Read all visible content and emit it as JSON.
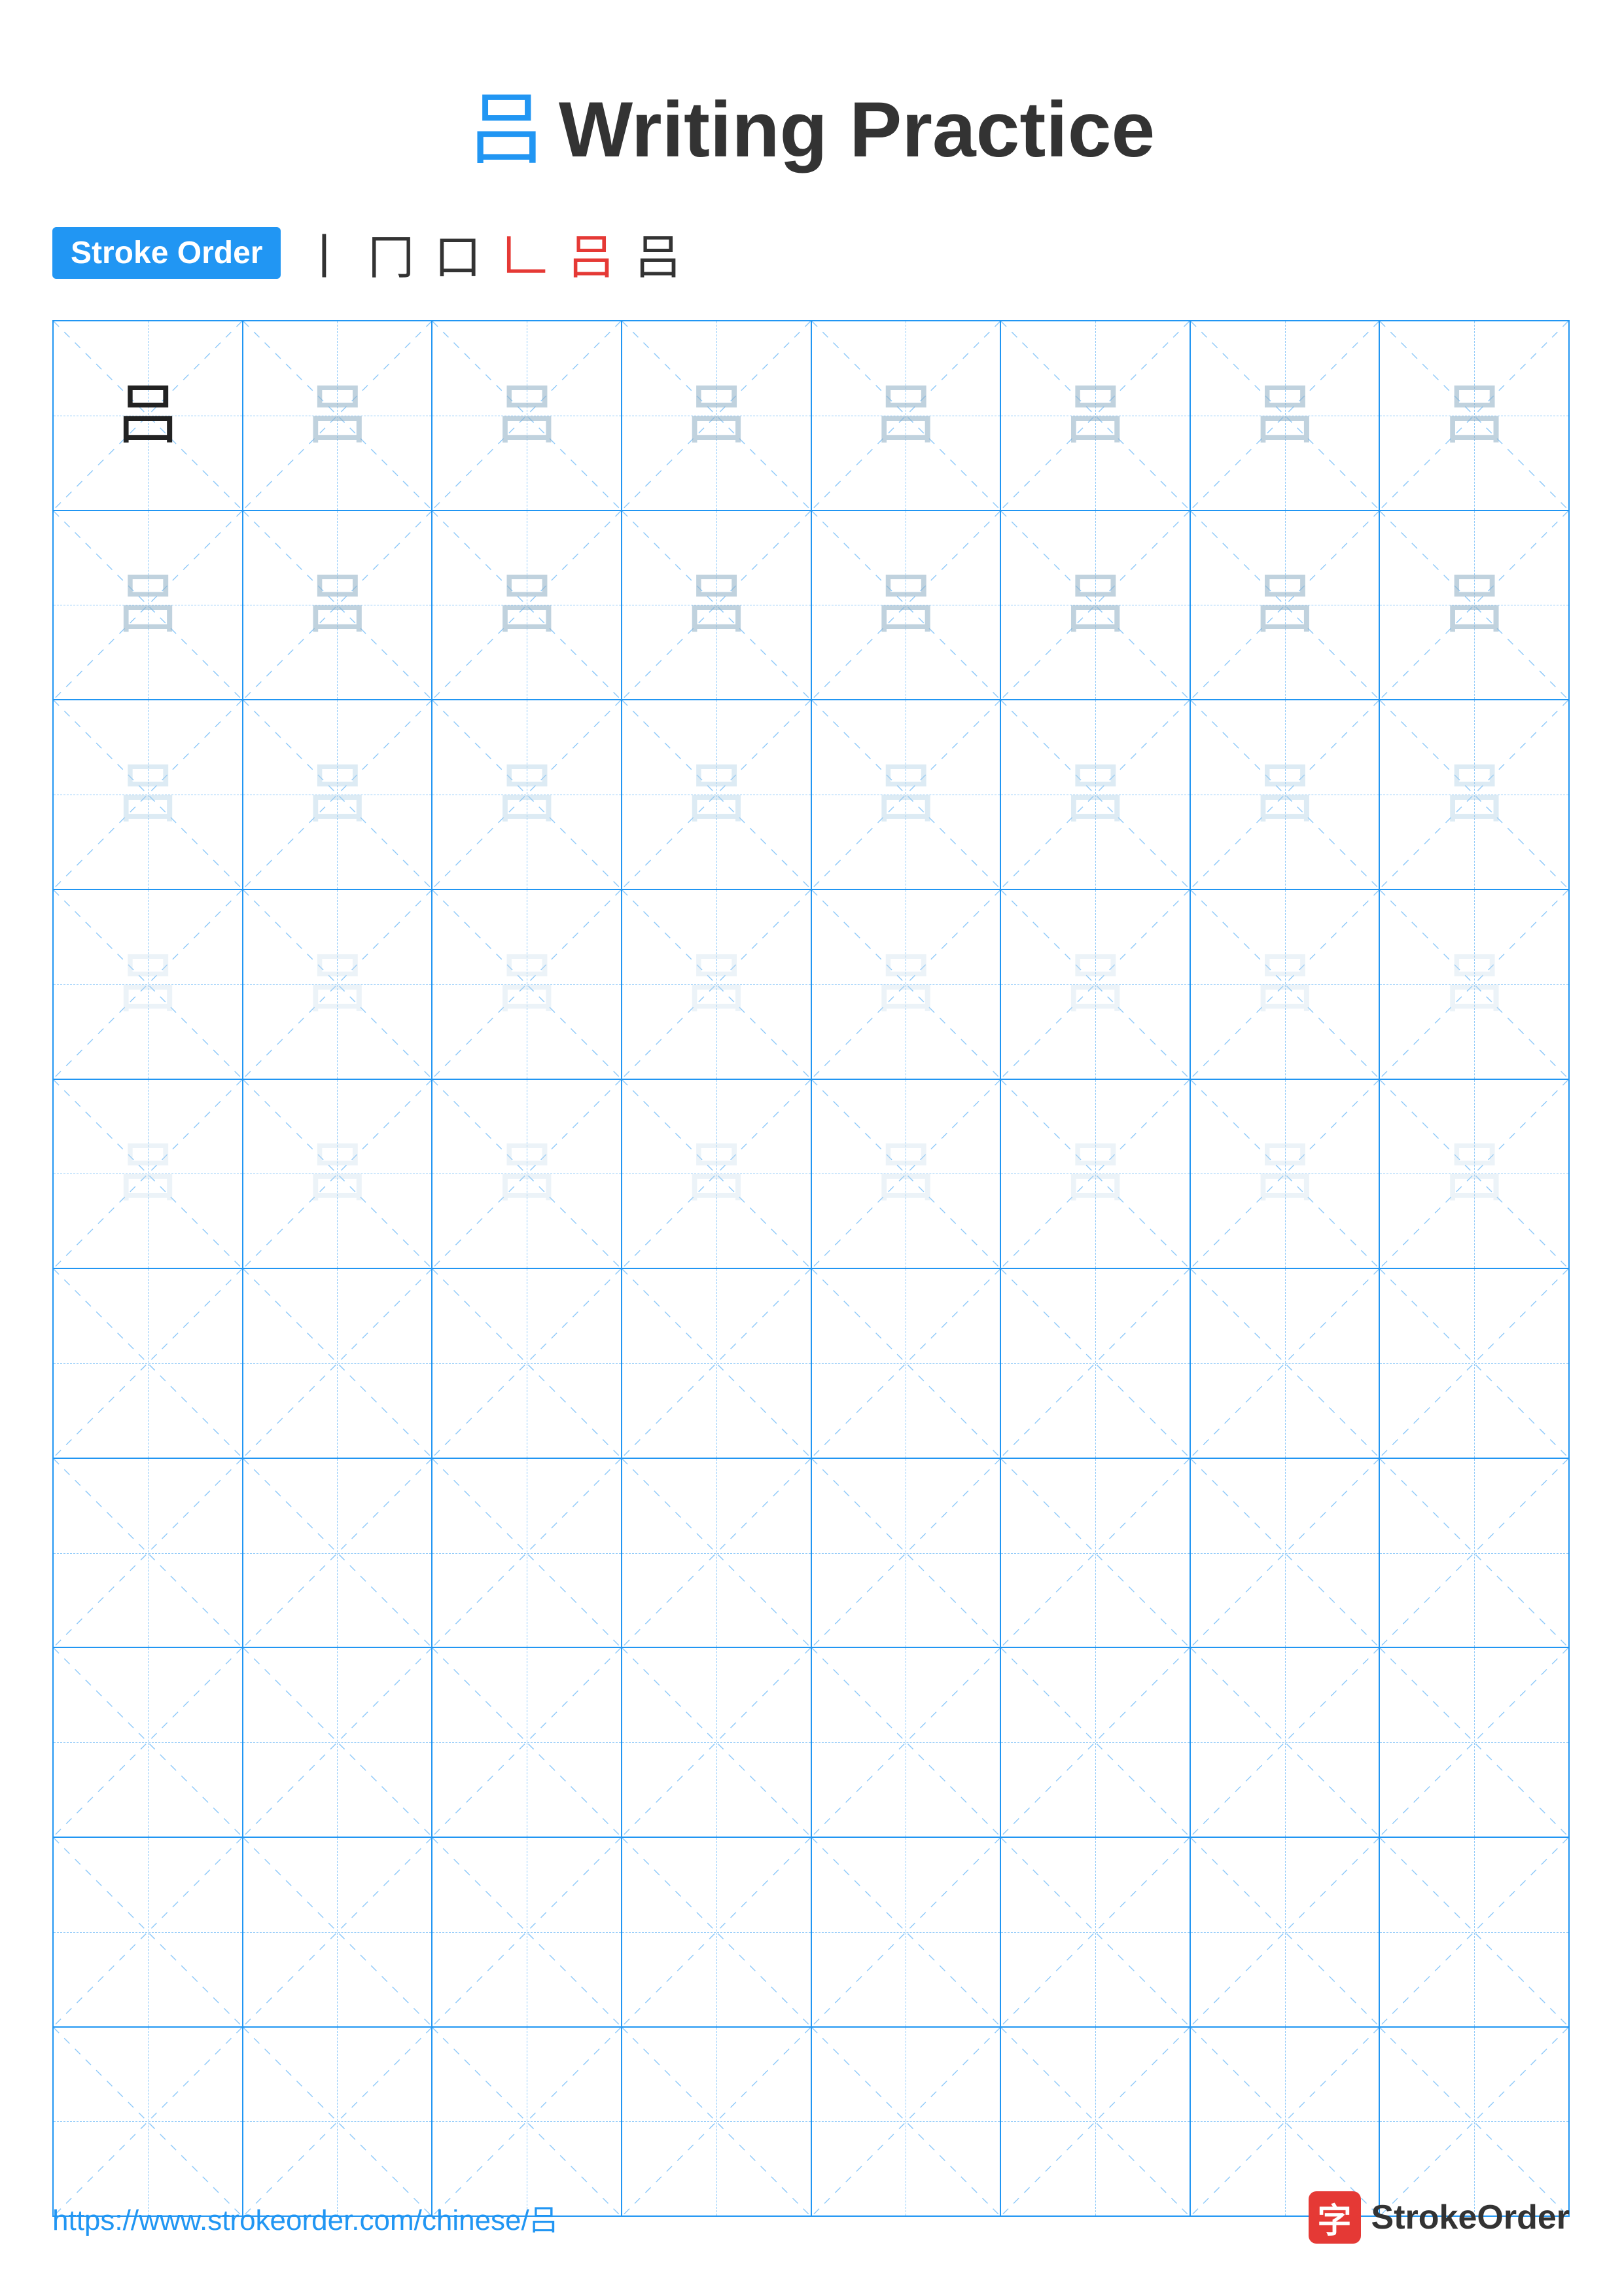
{
  "title": {
    "char": "吕",
    "text": "Writing Practice"
  },
  "stroke_order": {
    "badge_label": "Stroke Order",
    "steps": [
      "丨",
      "冂",
      "口",
      "𠃊",
      "吕",
      "吕"
    ]
  },
  "grid": {
    "cols": 8,
    "rows": 10,
    "char": "吕",
    "guide_rows": 5
  },
  "footer": {
    "url": "https://www.strokeorder.com/chinese/吕",
    "logo_char": "字",
    "logo_text": "StrokeOrder"
  }
}
